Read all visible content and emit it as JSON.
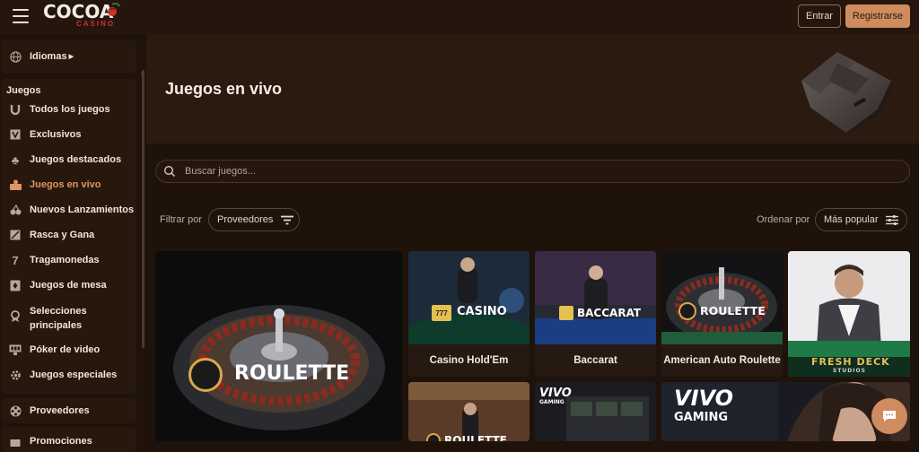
{
  "header": {
    "logo_text": "COCOA",
    "logo_sub": "CASINO",
    "login_label": "Entrar",
    "register_label": "Registrarse"
  },
  "sidebar": {
    "language_label": "Idiomas",
    "games_heading": "Juegos",
    "items": [
      {
        "label": "Todos los juegos",
        "icon": "horseshoe-icon"
      },
      {
        "label": "Exclusivos",
        "icon": "exclusive-icon"
      },
      {
        "label": "Juegos destacados",
        "icon": "clover-icon"
      },
      {
        "label": "Juegos en vivo",
        "icon": "live-dealer-icon",
        "active": true
      },
      {
        "label": "Nuevos Lanzamientos",
        "icon": "cherries-icon"
      },
      {
        "label": "Rasca y Gana",
        "icon": "scratch-card-icon"
      },
      {
        "label": "Tragamonedas",
        "icon": "seven-icon"
      },
      {
        "label": "Juegos de mesa",
        "icon": "table-game-icon"
      },
      {
        "label": "Selecciones principales",
        "icon": "award-icon"
      },
      {
        "label": "Póker de video",
        "icon": "video-poker-icon"
      },
      {
        "label": "Juegos especiales",
        "icon": "special-games-icon"
      }
    ],
    "providers_label": "Proveedores",
    "promotions_label": "Promociones"
  },
  "hero": {
    "title": "Juegos en vivo"
  },
  "search": {
    "placeholder": "Buscar juegos..."
  },
  "filters": {
    "filter_label": "Filtrar por",
    "providers_pill": "Proveedores",
    "order_label": "Ordenar por",
    "order_value": "Más popular"
  },
  "games": [
    {
      "title": "",
      "art_label": "ROULETTE"
    },
    {
      "title": "Casino Hold'Em",
      "art_label": "CASINO"
    },
    {
      "title": "Baccarat",
      "art_label": "BACCARAT"
    },
    {
      "title": "American Auto Roulette",
      "art_label": "ROULETTE"
    },
    {
      "title": "",
      "art_label": "FRESH DECK",
      "art_sub": "STUDIOS"
    },
    {
      "title": "",
      "art_label": "ROULETTE"
    },
    {
      "title": "",
      "art_label": "VIVO",
      "art_sub": "GAMING"
    },
    {
      "title": "",
      "art_label": "VIVO",
      "art_sub": "GAMING"
    }
  ],
  "colors": {
    "accent": "#cf8d5f",
    "active_nav": "#e0955e",
    "background": "#1e120b"
  }
}
